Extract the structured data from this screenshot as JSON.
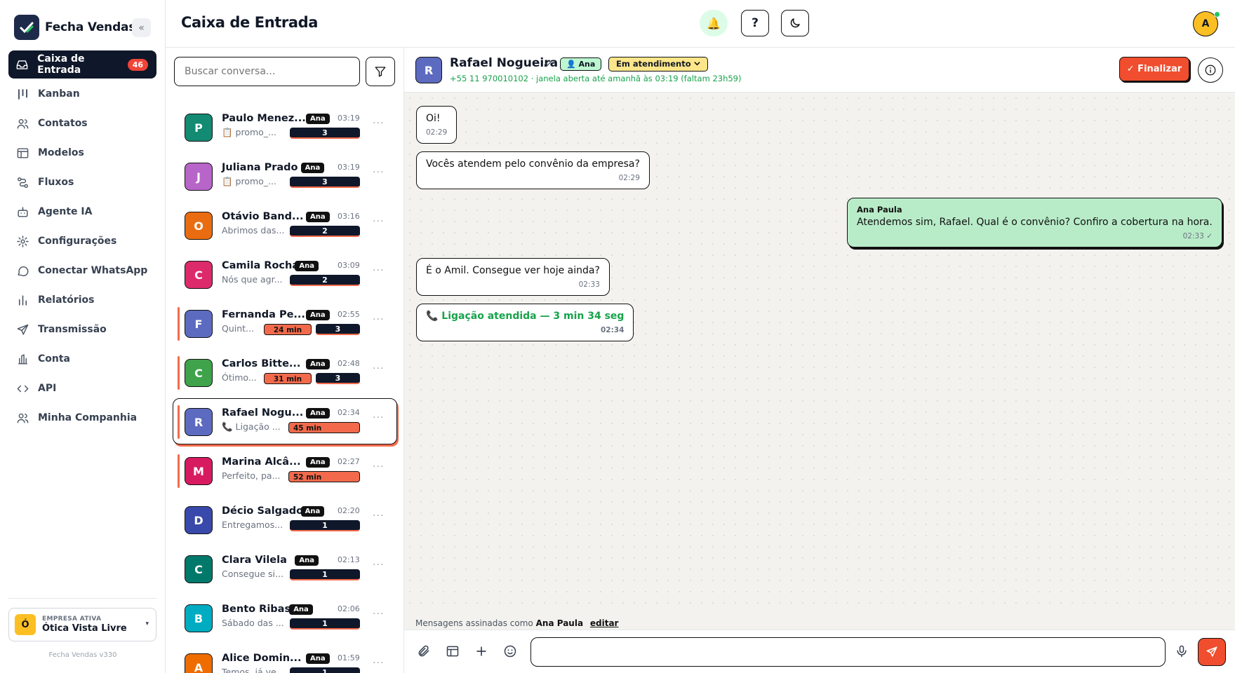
{
  "brand": {
    "name": "Fecha Vendas",
    "collapse_glyph": "«"
  },
  "sidebar": {
    "items": [
      {
        "label": "Caixa de Entrada",
        "icon": "inbox-icon",
        "badge": "46",
        "active": true
      },
      {
        "label": "Kanban",
        "icon": "kanban-icon"
      },
      {
        "label": "Contatos",
        "icon": "users-icon"
      },
      {
        "label": "Modelos",
        "icon": "template-icon"
      },
      {
        "label": "Fluxos",
        "icon": "flow-icon"
      },
      {
        "label": "Agente IA",
        "icon": "bot-icon"
      },
      {
        "label": "Configurações",
        "icon": "gear-icon"
      },
      {
        "label": "Conectar WhatsApp",
        "icon": "chat-icon"
      },
      {
        "label": "Relatórios",
        "icon": "chart-icon"
      },
      {
        "label": "Transmissão",
        "icon": "send-icon"
      },
      {
        "label": "Conta",
        "icon": "bank-icon"
      },
      {
        "label": "API",
        "icon": "code-icon"
      },
      {
        "label": "Minha Companhia",
        "icon": "team-icon"
      }
    ],
    "company": {
      "label": "EMPRESA ATIVA",
      "name": "Ótica Vista Livre",
      "initial": "Ó",
      "caret": "▾"
    },
    "version": "Fecha Vendas v330"
  },
  "header": {
    "title": "Caixa de Entrada",
    "help": "?",
    "user_initial": "A",
    "bell": "🔔"
  },
  "conv_list": {
    "search_placeholder": "Buscar conversa...",
    "items": [
      {
        "initial": "P",
        "color": "#138a72",
        "name": "Paulo Menez...",
        "tag": "Ana",
        "time": "03:19",
        "preview": "📋 promo_...",
        "count": "3"
      },
      {
        "initial": "J",
        "color": "#b865c9",
        "name": "Juliana Prado",
        "tag": "Ana",
        "time": "03:19",
        "preview": "📋 promo_...",
        "count": "3"
      },
      {
        "initial": "O",
        "color": "#ea6c10",
        "name": "Otávio Band...",
        "tag": "Ana",
        "time": "03:16",
        "preview": "Abrimos das...",
        "count": "2"
      },
      {
        "initial": "C",
        "color": "#dd2a6b",
        "name": "Camila Rocha",
        "tag": "Ana",
        "time": "03:09",
        "preview": "Nós que agr...",
        "count": "2"
      },
      {
        "initial": "F",
        "color": "#5c6bc0",
        "name": "Fernanda Pe...",
        "tag": "Ana",
        "time": "02:55",
        "preview": "Quint...",
        "wait": "24 min",
        "count": "3",
        "flag": true
      },
      {
        "initial": "C",
        "color": "#3ea34a",
        "name": "Carlos Bitte...",
        "tag": "Ana",
        "time": "02:48",
        "preview": "Ótimo...",
        "wait": "31 min",
        "count": "3",
        "flag": true
      },
      {
        "initial": "R",
        "color": "#5c6bc0",
        "name": "Rafael Nogu...",
        "tag": "Ana",
        "time": "02:34",
        "preview": "📞 Ligação ...",
        "wait": "45 min",
        "flag": true,
        "selected": true
      },
      {
        "initial": "M",
        "color": "#d81b60",
        "name": "Marina Alcâ...",
        "tag": "Ana",
        "time": "02:27",
        "preview": "Perfeito, pa...",
        "wait": "52 min",
        "flag": true
      },
      {
        "initial": "D",
        "color": "#3949ab",
        "name": "Décio Salgado",
        "tag": "Ana",
        "time": "02:20",
        "preview": "Entregamos...",
        "count": "1"
      },
      {
        "initial": "C",
        "color": "#00796b",
        "name": "Clara Vilela",
        "tag": "Ana",
        "time": "02:13",
        "preview": "Consegue si...",
        "count": "1"
      },
      {
        "initial": "B",
        "color": "#00acc1",
        "name": "Bento Ribas",
        "tag": "Ana",
        "time": "02:06",
        "preview": "Sábado das ...",
        "count": "1"
      },
      {
        "initial": "A",
        "color": "#ef6c00",
        "name": "Alice Domin...",
        "tag": "Ana",
        "time": "01:59",
        "preview": "Temos, já ve...",
        "count": "1"
      }
    ]
  },
  "chat": {
    "initial": "R",
    "name": "Rafael Nogueira",
    "agent": "👤 Ana",
    "status": "Em atendimento",
    "subtitle": "+55 11 970010102 · janela aberta até amanhã às 03:19 (faltam 23h59)",
    "finalize": "✓ Finalizar",
    "messages": [
      {
        "dir": "in",
        "text": "Oi!",
        "time": "02:29"
      },
      {
        "dir": "in",
        "text": "Vocês atendem pelo convênio da empresa?",
        "time": "02:29"
      },
      {
        "dir": "out",
        "sender": "Ana Paula",
        "text": "Atendemos sim, Rafael. Qual é o convênio? Confiro a cobertura na hora.",
        "time": "02:33 ✓"
      },
      {
        "dir": "in",
        "text": "É o Amil. Consegue ver hoje ainda?",
        "time": "02:33"
      },
      {
        "dir": "call",
        "text": "📞 Ligação atendida — 3 min 34 seg",
        "time": "02:34"
      }
    ],
    "signature": {
      "prefix": "Mensagens assinadas como",
      "name": "Ana Paula",
      "edit": "editar"
    }
  }
}
